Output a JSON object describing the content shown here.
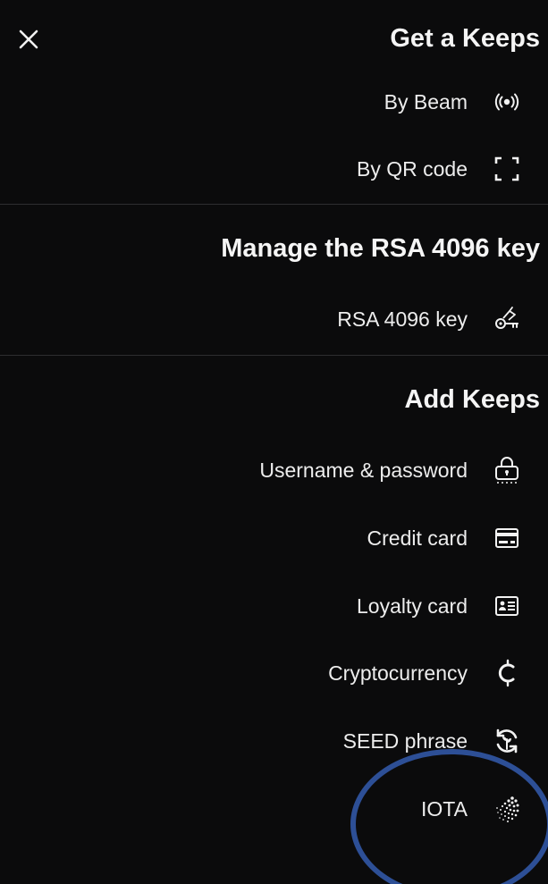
{
  "header": {
    "close_icon": "close-icon"
  },
  "sections": {
    "get_keeps": {
      "title": "Get a Keeps",
      "items": [
        {
          "label": "By Beam",
          "icon": "beam-icon"
        },
        {
          "label": "By QR code",
          "icon": "qr-scan-icon"
        }
      ]
    },
    "manage_rsa": {
      "title": "Manage the RSA 4096 key",
      "items": [
        {
          "label": "RSA 4096 key",
          "icon": "key-icon"
        }
      ]
    },
    "add_keeps": {
      "title": "Add Keeps",
      "items": [
        {
          "label": "Username & password",
          "icon": "lock-icon"
        },
        {
          "label": "Credit card",
          "icon": "credit-card-icon"
        },
        {
          "label": "Loyalty card",
          "icon": "loyalty-card-icon"
        },
        {
          "label": "Cryptocurrency",
          "icon": "cryptocurrency-icon"
        },
        {
          "label": "SEED phrase",
          "icon": "seed-phrase-icon"
        },
        {
          "label": "IOTA",
          "icon": "iota-icon"
        }
      ]
    }
  },
  "colors": {
    "background": "#0b0b0c",
    "text": "#f2f2f2",
    "divider": "#2e2e30",
    "highlight": "#2d4f96"
  }
}
